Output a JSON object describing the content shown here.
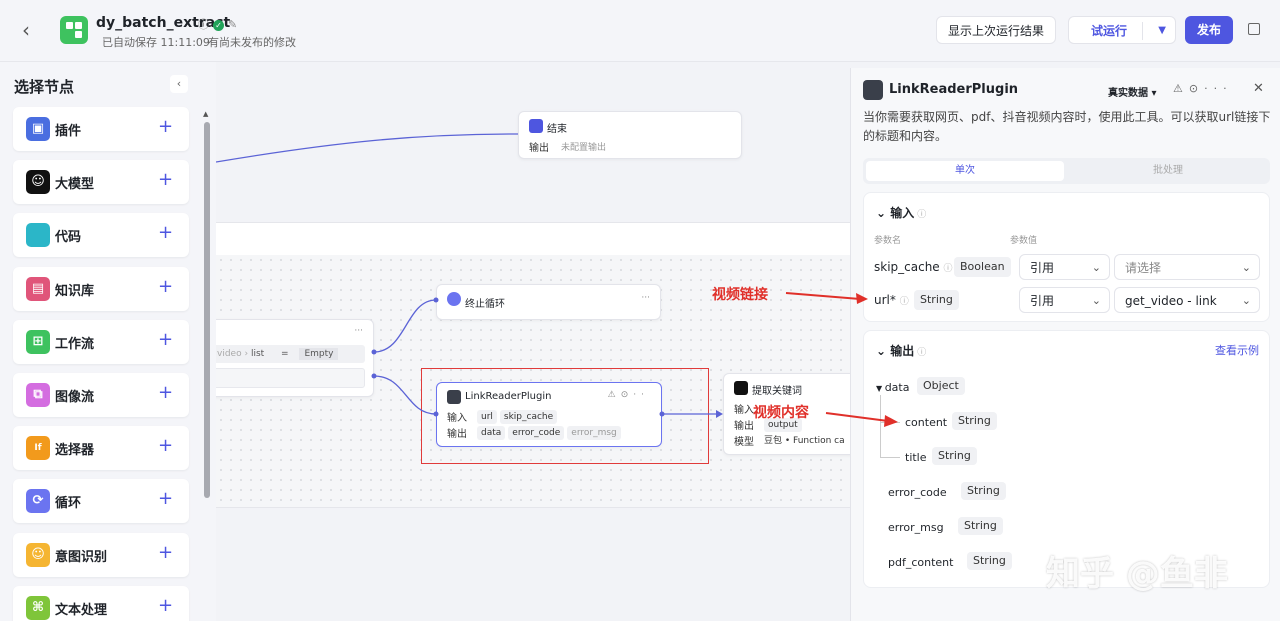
{
  "header": {
    "title": "dy_batch_extract",
    "autosave": "已自动保存 11:11:09",
    "unpublished": "有尚未发布的修改",
    "show_last_result": "显示上次运行结果",
    "test_run": "试运行",
    "publish": "发布"
  },
  "left_panel": {
    "title": "选择节点",
    "items": [
      {
        "label": "插件",
        "color": "#4a6ee0"
      },
      {
        "label": "大模型",
        "color": "#111111"
      },
      {
        "label": "代码",
        "color": "#2bb6c8"
      },
      {
        "label": "知识库",
        "color": "#e0557a"
      },
      {
        "label": "工作流",
        "color": "#3ec25f"
      },
      {
        "label": "图像流",
        "color": "#d46de0"
      },
      {
        "label": "选择器",
        "color": "#f29a1c"
      },
      {
        "label": "循环",
        "color": "#6b74f0"
      },
      {
        "label": "意图识别",
        "color": "#f5b532"
      },
      {
        "label": "文本处理",
        "color": "#7fc53a"
      }
    ]
  },
  "canvas": {
    "end_node": {
      "title": "结束",
      "output_label": "输出",
      "output_value": "未配置输出"
    },
    "stop_loop": {
      "title": "终止循环"
    },
    "condition": {
      "var": "video",
      "sub": "list",
      "op": "=",
      "value": "Empty"
    },
    "plugin_node": {
      "title": "LinkReaderPlugin",
      "input_label": "输入",
      "inputs": [
        "url",
        "skip_cache"
      ],
      "output_label": "输出",
      "outputs": [
        "data",
        "error_code",
        "error_msg"
      ]
    },
    "keyword_node": {
      "title": "提取关键词",
      "input_label": "输入",
      "output_label": "输出",
      "output_value": "output",
      "model_label": "模型",
      "model_value": "豆包 • Function ca"
    }
  },
  "right_panel": {
    "title": "LinkReaderPlugin",
    "data_mode": "真实数据",
    "description": "当你需要获取网页、pdf、抖音视频内容时，使用此工具。可以获取url链接下的标题和内容。",
    "tabs": [
      "单次",
      "批处理"
    ],
    "input_section": {
      "title": "输入",
      "col_name": "参数名",
      "col_value": "参数值",
      "params": [
        {
          "name": "skip_cache",
          "type": "Boolean",
          "mode": "引用",
          "value": "请选择"
        },
        {
          "name": "url*",
          "type": "String",
          "mode": "引用",
          "value": "get_video - link"
        }
      ]
    },
    "output_section": {
      "title": "输出",
      "see_example": "查看示例",
      "fields": [
        {
          "name": "data",
          "type": "Object"
        },
        {
          "name": "content",
          "type": "String"
        },
        {
          "name": "title",
          "type": "String"
        },
        {
          "name": "error_code",
          "type": "String"
        },
        {
          "name": "error_msg",
          "type": "String"
        },
        {
          "name": "pdf_content",
          "type": "String"
        }
      ]
    }
  },
  "annotations": {
    "video_link": "视频链接",
    "video_content": "视频内容"
  },
  "watermark": "知乎 @鱼非",
  "colors": {
    "accent": "#4e56e0",
    "annotation": "#e0302a"
  }
}
